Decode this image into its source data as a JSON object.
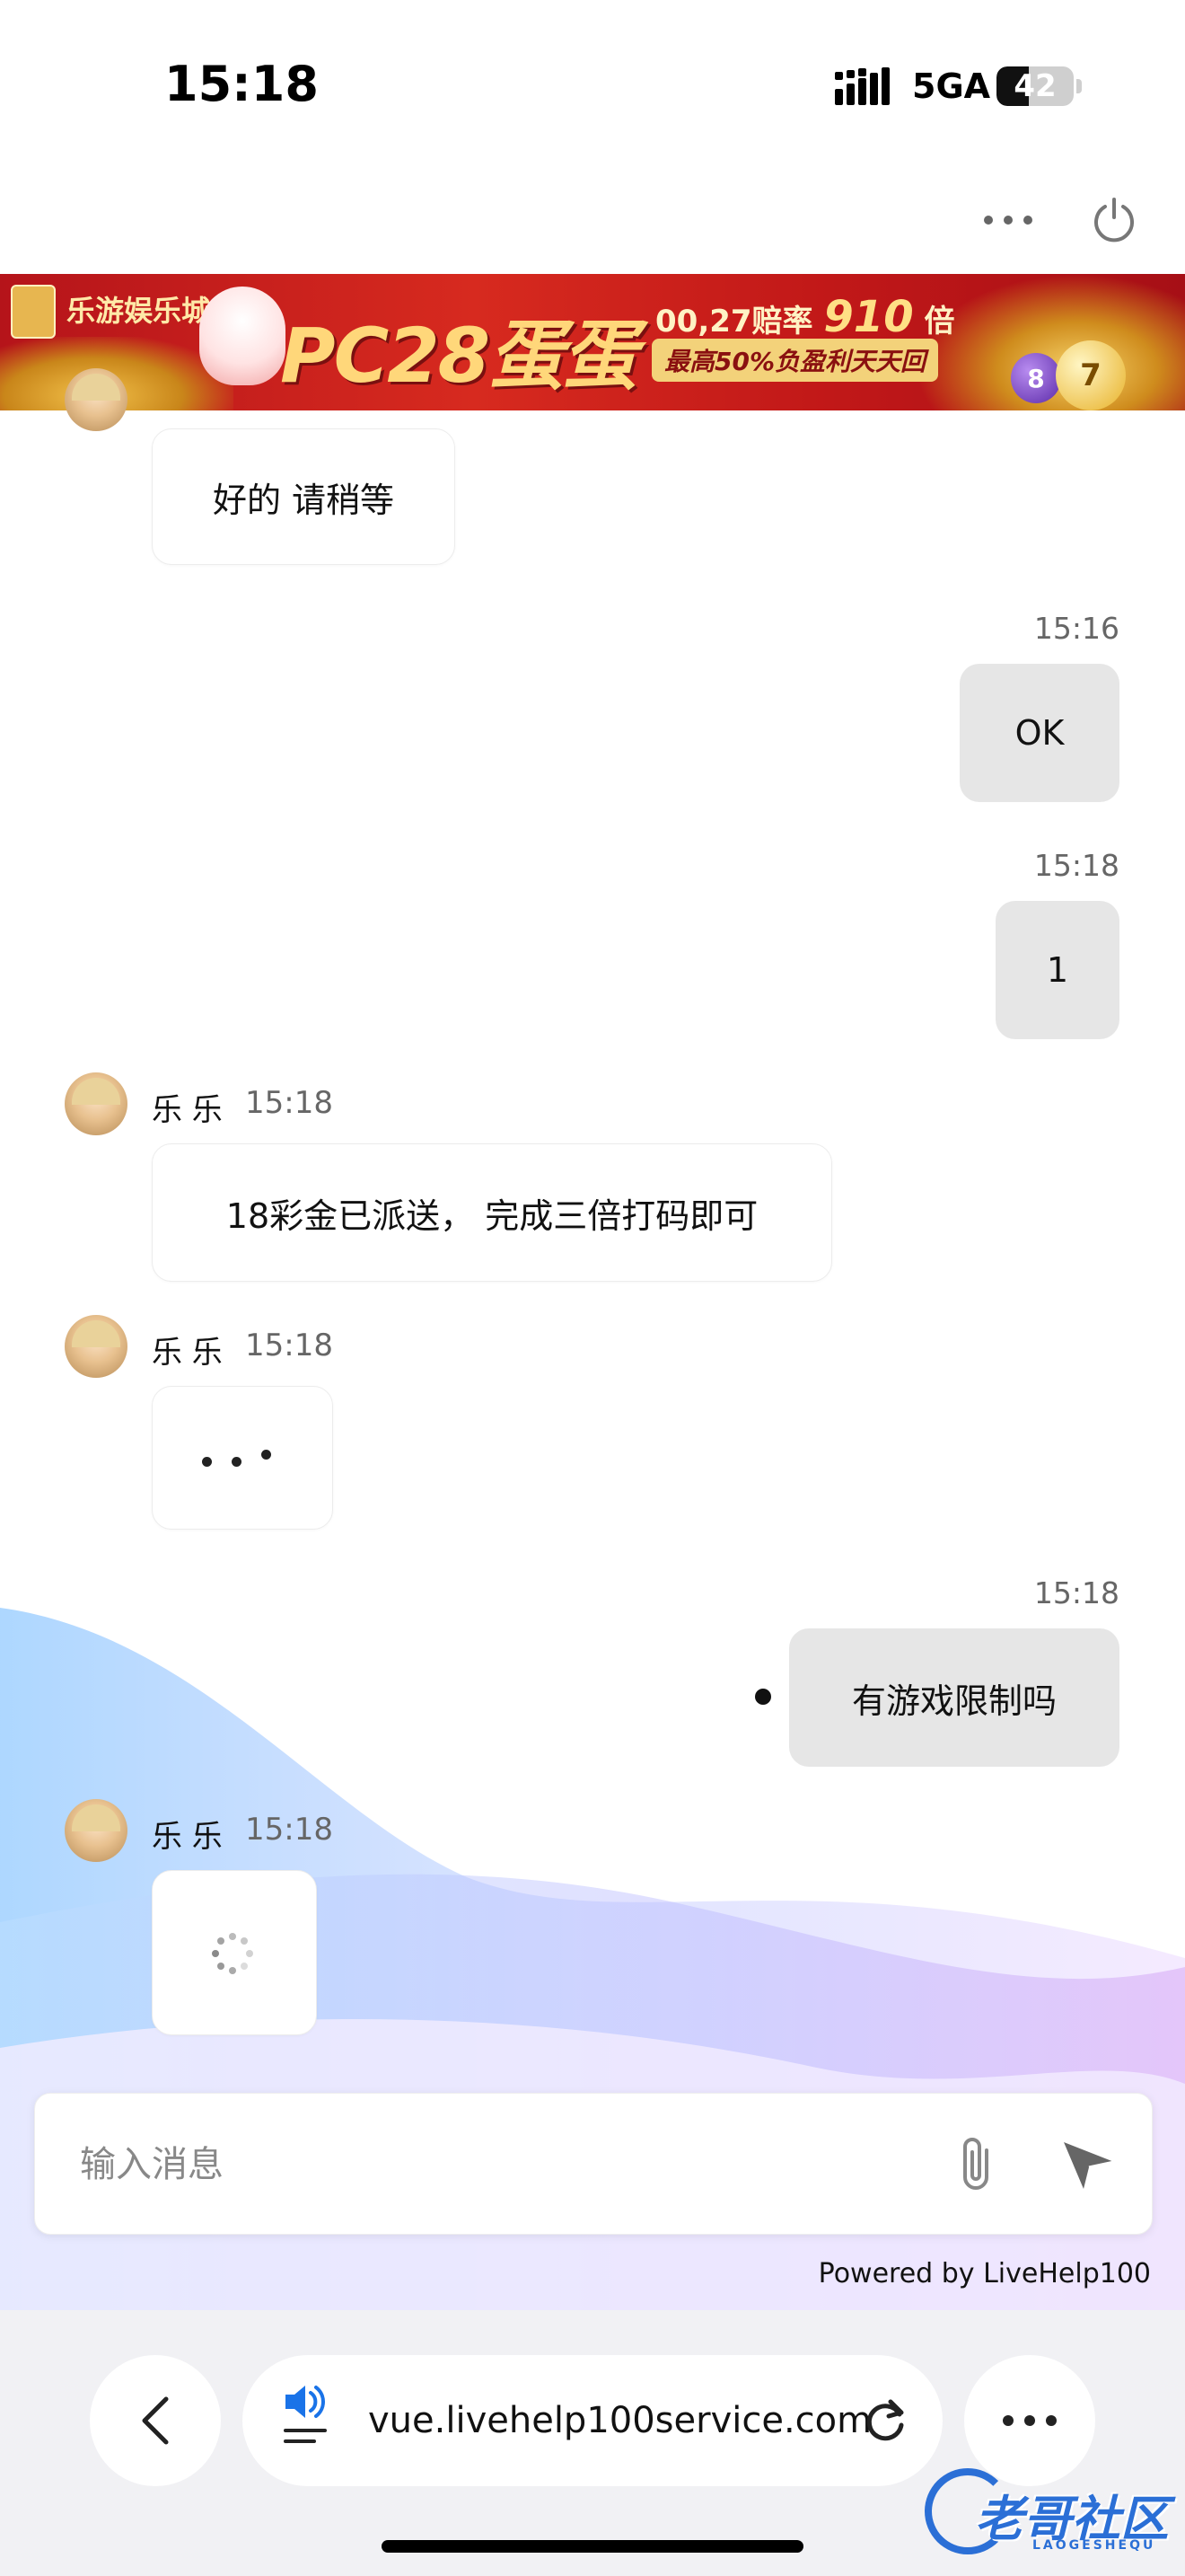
{
  "status_bar": {
    "time": "15:18",
    "network": "5GA",
    "battery": "42",
    "battery_level": 0.42
  },
  "banner": {
    "brand": "乐游娱乐城",
    "title": "PC28蛋蛋",
    "rate_prefix": "00,27赔率",
    "rate_value": "910",
    "rate_suffix": "倍",
    "subtitle": "最高50%负盈利天天回",
    "ball_numbers": [
      "8",
      "7"
    ]
  },
  "messages": [
    {
      "id": "m1",
      "side": "left",
      "text": "好的 请稍等"
    },
    {
      "id": "m2",
      "side": "right",
      "time": "15:16",
      "text": "OK"
    },
    {
      "id": "m3",
      "side": "right",
      "time": "15:18",
      "text": "1"
    },
    {
      "id": "m4",
      "side": "left",
      "sender": "乐 乐",
      "time": "15:18",
      "text": "18彩金已派送， 完成三倍打码即可"
    },
    {
      "id": "m5",
      "side": "left",
      "sender": "乐 乐",
      "time": "15:18",
      "typing": true
    },
    {
      "id": "m6",
      "side": "right",
      "time": "15:18",
      "text": "有游戏限制吗"
    },
    {
      "id": "m7",
      "side": "left",
      "sender": "乐 乐",
      "time": "15:18",
      "loading": true
    }
  ],
  "composer": {
    "placeholder": "输入消息",
    "value": ""
  },
  "powered_by": "Powered by LiveHelp100",
  "browser": {
    "url": "vue.livehelp100service.com"
  },
  "watermark": {
    "text": "老哥社区",
    "sub": "LAOGESHEQU"
  },
  "colors": {
    "banner_red": "#c8191b",
    "banner_gold": "#ffd77a",
    "user_bubble": "#e6e6e6",
    "agent_bubble": "#ffffff",
    "watermark_blue": "#2b6fd6"
  }
}
